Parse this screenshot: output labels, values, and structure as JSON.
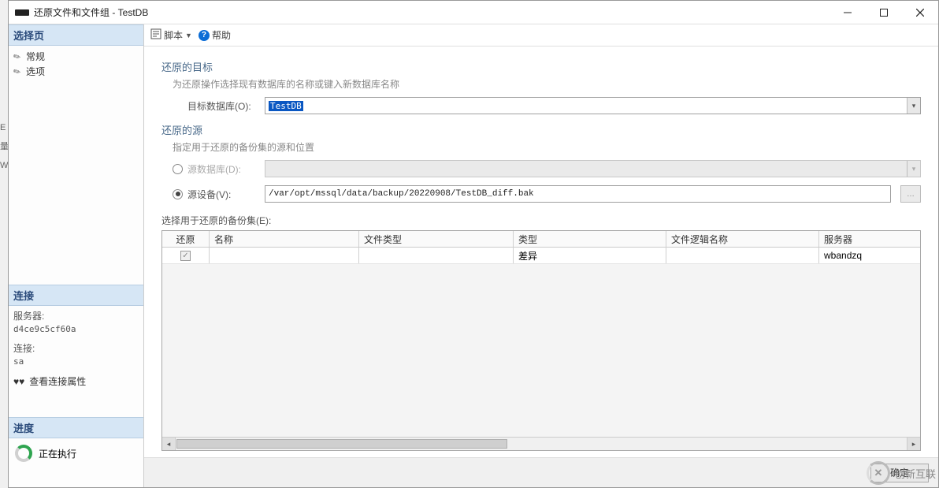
{
  "window": {
    "title": "还原文件和文件组 - TestDB"
  },
  "sidebar": {
    "select_page_label": "选择页",
    "pages": [
      {
        "label": "常规"
      },
      {
        "label": "选项"
      }
    ],
    "connection_label": "连接",
    "server_label": "服务器:",
    "server_value": "d4ce9c5cf60a",
    "conn_label": "连接:",
    "conn_value": "sa",
    "view_props": "查看连接属性",
    "progress_label": "进度",
    "progress_status": "正在执行"
  },
  "toolbar": {
    "script_label": "脚本",
    "help_label": "帮助"
  },
  "target": {
    "section_label": "还原的目标",
    "sub_label": "为还原操作选择现有数据库的名称或键入新数据库名称",
    "db_label": "目标数据库(O):",
    "db_value": "TestDB"
  },
  "source": {
    "section_label": "还原的源",
    "sub_label": "指定用于还原的备份集的源和位置",
    "src_db_label": "源数据库(D):",
    "src_dev_label": "源设备(V):",
    "src_dev_value": "/var/opt/mssql/data/backup/20220908/TestDB_diff.bak",
    "grid_label": "选择用于还原的备份集(E):"
  },
  "grid": {
    "headers": {
      "restore": "还原",
      "name": "名称",
      "file_type": "文件类型",
      "type": "类型",
      "file_logical_name": "文件逻辑名称",
      "server": "服务器"
    },
    "rows": [
      {
        "restore": true,
        "name": "",
        "file_type": "",
        "type": "差异",
        "file_logical_name": "",
        "server": "wbandzq"
      }
    ]
  },
  "footer": {
    "ok": "确定"
  },
  "watermark": {
    "brand": "创新互联"
  }
}
